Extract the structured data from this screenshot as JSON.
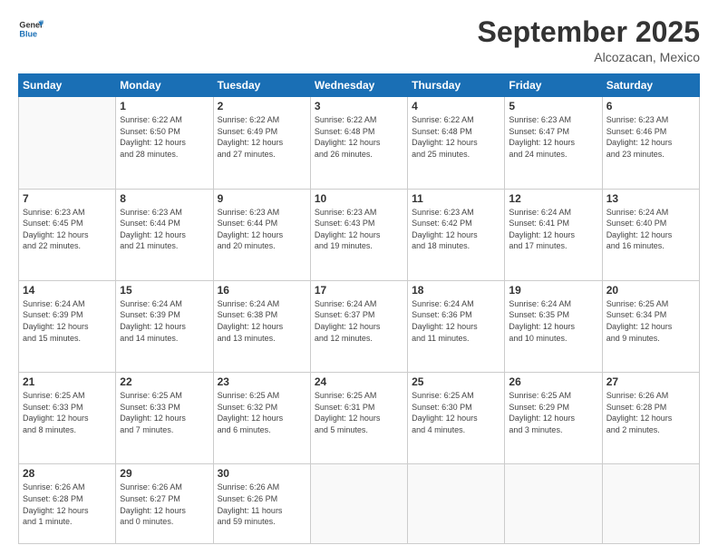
{
  "logo": {
    "line1": "General",
    "line2": "Blue"
  },
  "header": {
    "month": "September 2025",
    "location": "Alcozacan, Mexico"
  },
  "weekdays": [
    "Sunday",
    "Monday",
    "Tuesday",
    "Wednesday",
    "Thursday",
    "Friday",
    "Saturday"
  ],
  "weeks": [
    [
      {
        "day": "",
        "info": ""
      },
      {
        "day": "1",
        "info": "Sunrise: 6:22 AM\nSunset: 6:50 PM\nDaylight: 12 hours\nand 28 minutes."
      },
      {
        "day": "2",
        "info": "Sunrise: 6:22 AM\nSunset: 6:49 PM\nDaylight: 12 hours\nand 27 minutes."
      },
      {
        "day": "3",
        "info": "Sunrise: 6:22 AM\nSunset: 6:48 PM\nDaylight: 12 hours\nand 26 minutes."
      },
      {
        "day": "4",
        "info": "Sunrise: 6:22 AM\nSunset: 6:48 PM\nDaylight: 12 hours\nand 25 minutes."
      },
      {
        "day": "5",
        "info": "Sunrise: 6:23 AM\nSunset: 6:47 PM\nDaylight: 12 hours\nand 24 minutes."
      },
      {
        "day": "6",
        "info": "Sunrise: 6:23 AM\nSunset: 6:46 PM\nDaylight: 12 hours\nand 23 minutes."
      }
    ],
    [
      {
        "day": "7",
        "info": "Sunrise: 6:23 AM\nSunset: 6:45 PM\nDaylight: 12 hours\nand 22 minutes."
      },
      {
        "day": "8",
        "info": "Sunrise: 6:23 AM\nSunset: 6:44 PM\nDaylight: 12 hours\nand 21 minutes."
      },
      {
        "day": "9",
        "info": "Sunrise: 6:23 AM\nSunset: 6:44 PM\nDaylight: 12 hours\nand 20 minutes."
      },
      {
        "day": "10",
        "info": "Sunrise: 6:23 AM\nSunset: 6:43 PM\nDaylight: 12 hours\nand 19 minutes."
      },
      {
        "day": "11",
        "info": "Sunrise: 6:23 AM\nSunset: 6:42 PM\nDaylight: 12 hours\nand 18 minutes."
      },
      {
        "day": "12",
        "info": "Sunrise: 6:24 AM\nSunset: 6:41 PM\nDaylight: 12 hours\nand 17 minutes."
      },
      {
        "day": "13",
        "info": "Sunrise: 6:24 AM\nSunset: 6:40 PM\nDaylight: 12 hours\nand 16 minutes."
      }
    ],
    [
      {
        "day": "14",
        "info": "Sunrise: 6:24 AM\nSunset: 6:39 PM\nDaylight: 12 hours\nand 15 minutes."
      },
      {
        "day": "15",
        "info": "Sunrise: 6:24 AM\nSunset: 6:39 PM\nDaylight: 12 hours\nand 14 minutes."
      },
      {
        "day": "16",
        "info": "Sunrise: 6:24 AM\nSunset: 6:38 PM\nDaylight: 12 hours\nand 13 minutes."
      },
      {
        "day": "17",
        "info": "Sunrise: 6:24 AM\nSunset: 6:37 PM\nDaylight: 12 hours\nand 12 minutes."
      },
      {
        "day": "18",
        "info": "Sunrise: 6:24 AM\nSunset: 6:36 PM\nDaylight: 12 hours\nand 11 minutes."
      },
      {
        "day": "19",
        "info": "Sunrise: 6:24 AM\nSunset: 6:35 PM\nDaylight: 12 hours\nand 10 minutes."
      },
      {
        "day": "20",
        "info": "Sunrise: 6:25 AM\nSunset: 6:34 PM\nDaylight: 12 hours\nand 9 minutes."
      }
    ],
    [
      {
        "day": "21",
        "info": "Sunrise: 6:25 AM\nSunset: 6:33 PM\nDaylight: 12 hours\nand 8 minutes."
      },
      {
        "day": "22",
        "info": "Sunrise: 6:25 AM\nSunset: 6:33 PM\nDaylight: 12 hours\nand 7 minutes."
      },
      {
        "day": "23",
        "info": "Sunrise: 6:25 AM\nSunset: 6:32 PM\nDaylight: 12 hours\nand 6 minutes."
      },
      {
        "day": "24",
        "info": "Sunrise: 6:25 AM\nSunset: 6:31 PM\nDaylight: 12 hours\nand 5 minutes."
      },
      {
        "day": "25",
        "info": "Sunrise: 6:25 AM\nSunset: 6:30 PM\nDaylight: 12 hours\nand 4 minutes."
      },
      {
        "day": "26",
        "info": "Sunrise: 6:25 AM\nSunset: 6:29 PM\nDaylight: 12 hours\nand 3 minutes."
      },
      {
        "day": "27",
        "info": "Sunrise: 6:26 AM\nSunset: 6:28 PM\nDaylight: 12 hours\nand 2 minutes."
      }
    ],
    [
      {
        "day": "28",
        "info": "Sunrise: 6:26 AM\nSunset: 6:28 PM\nDaylight: 12 hours\nand 1 minute."
      },
      {
        "day": "29",
        "info": "Sunrise: 6:26 AM\nSunset: 6:27 PM\nDaylight: 12 hours\nand 0 minutes."
      },
      {
        "day": "30",
        "info": "Sunrise: 6:26 AM\nSunset: 6:26 PM\nDaylight: 11 hours\nand 59 minutes."
      },
      {
        "day": "",
        "info": ""
      },
      {
        "day": "",
        "info": ""
      },
      {
        "day": "",
        "info": ""
      },
      {
        "day": "",
        "info": ""
      }
    ]
  ]
}
